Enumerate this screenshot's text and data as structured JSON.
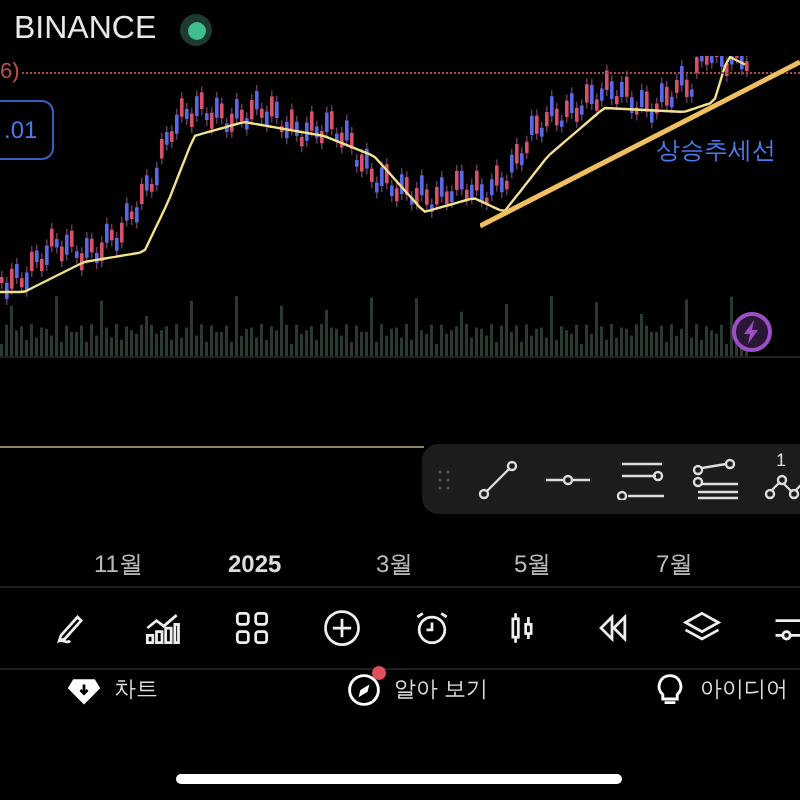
{
  "header": {
    "exchange": "BINANCE",
    "live": true
  },
  "chart": {
    "price_tag": "6)",
    "value_box": ".01",
    "trend_label": "상승추세선"
  },
  "drawing_toolbar": {
    "badge": "1"
  },
  "time_axis": [
    {
      "label": "11월",
      "kind": "month"
    },
    {
      "label": "2025",
      "kind": "year"
    },
    {
      "label": "3월",
      "kind": "month"
    },
    {
      "label": "5월",
      "kind": "month"
    },
    {
      "label": "7월",
      "kind": "month"
    }
  ],
  "bottom_nav": [
    {
      "label": "차트",
      "dot": false
    },
    {
      "label": "알아 보기",
      "dot": true
    },
    {
      "label": "아이디어",
      "dot": false
    }
  ]
}
